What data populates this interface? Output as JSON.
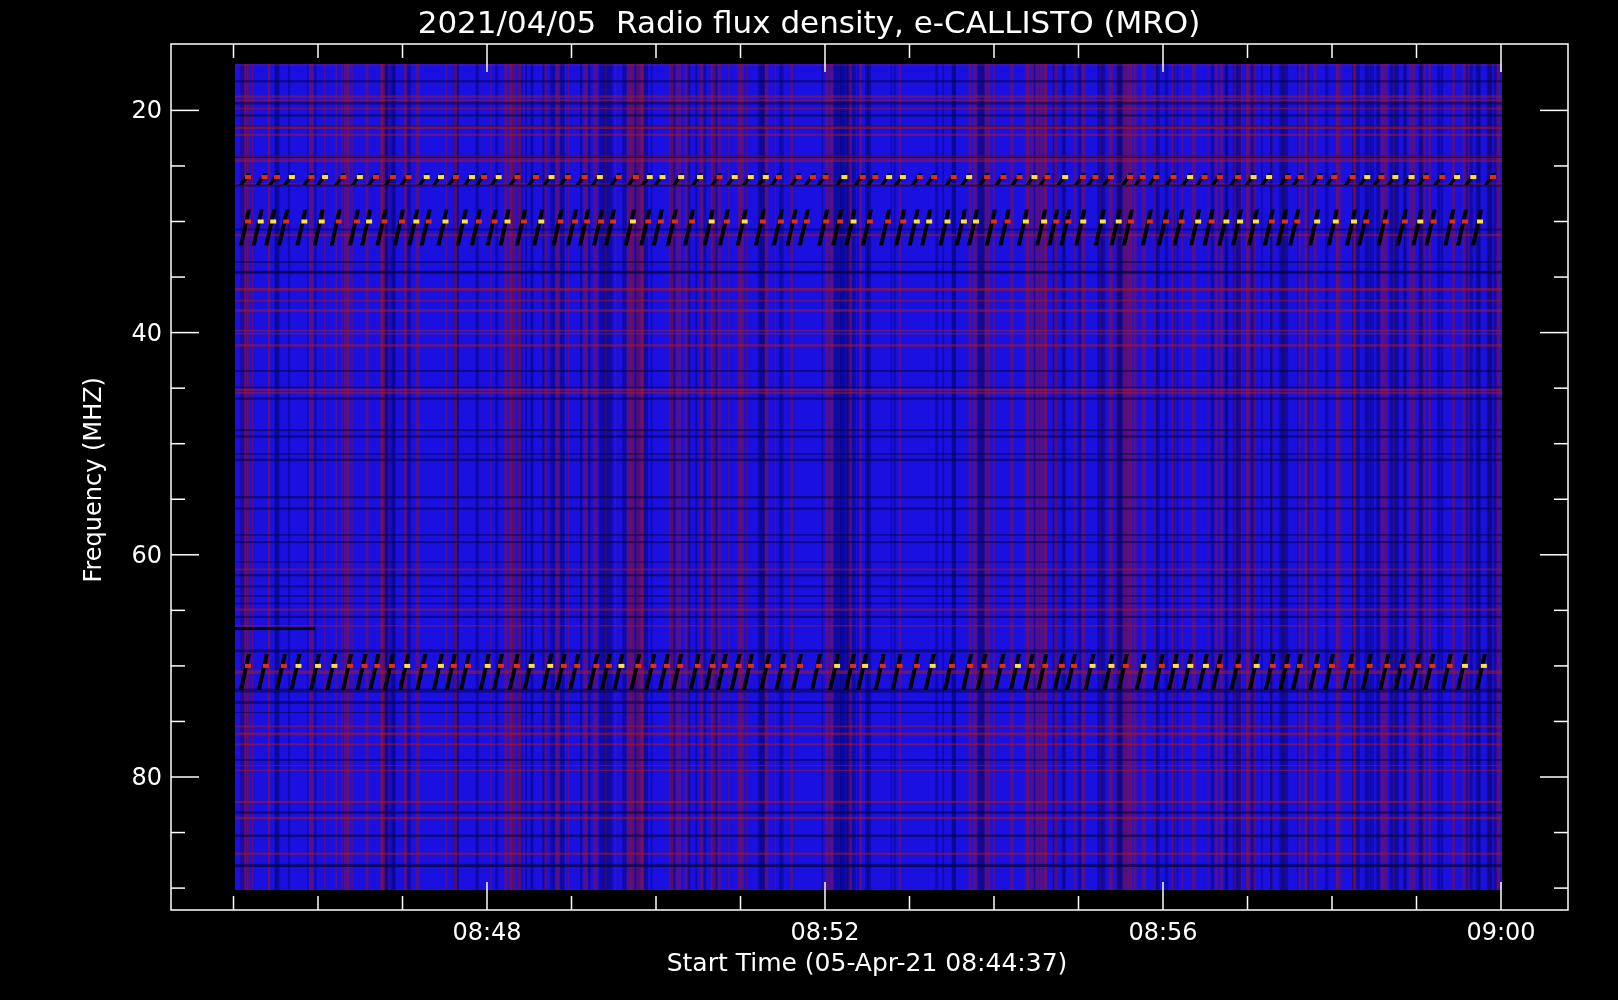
{
  "title": "2021/04/05  Radio flux density, e-CALLISTO (MRO)",
  "y_axis": {
    "label": "Frequency (MHZ)",
    "ticks": [
      "20",
      "40",
      "60",
      "80"
    ]
  },
  "x_axis": {
    "label": "Start Time (05-Apr-21 08:44:37)",
    "ticks": [
      "08:48",
      "08:52",
      "08:56",
      "09:00"
    ]
  }
}
